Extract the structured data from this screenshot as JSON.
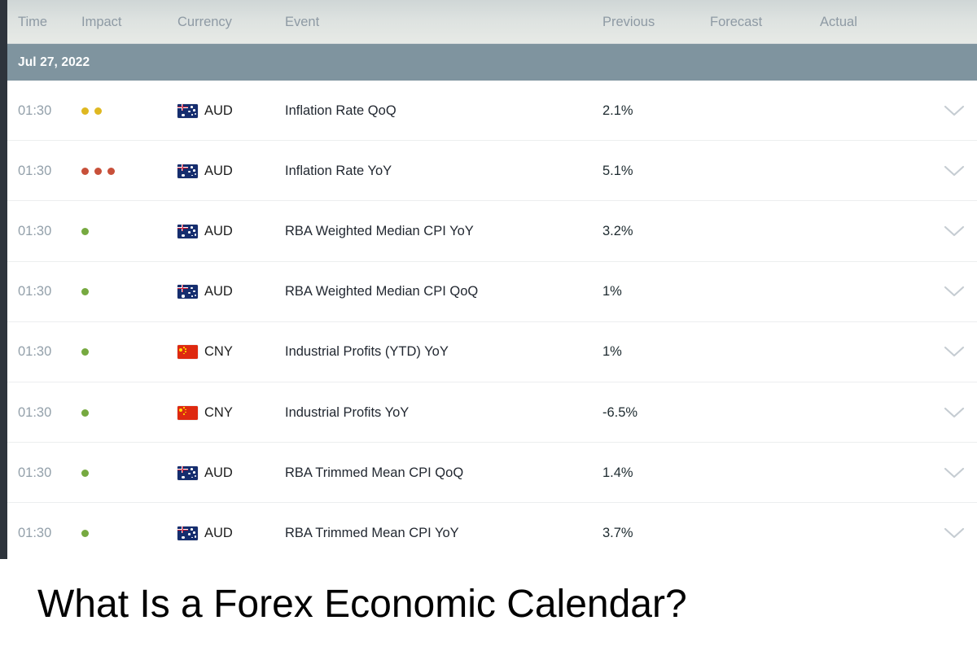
{
  "caption": "What Is a Forex Economic Calendar?",
  "calendar": {
    "columns": {
      "time": "Time",
      "impact": "Impact",
      "currency": "Currency",
      "event": "Event",
      "previous": "Previous",
      "forecast": "Forecast",
      "actual": "Actual"
    },
    "date_banner": "Jul 27, 2022",
    "colors": {
      "banner_bg": "#7f949f",
      "header_bg": "#dde2e0",
      "left_rail": "#2e343c",
      "impact_low": "#76a940",
      "impact_medium": "#dfb821",
      "impact_high": "#c8503a",
      "row_divider": "#eceeef"
    },
    "rows": [
      {
        "time": "01:30",
        "impact_level": 2,
        "impact_label": "medium",
        "flag": "aud-flag",
        "currency": "AUD",
        "event": "Inflation Rate QoQ",
        "previous": "2.1%",
        "forecast": "",
        "actual": "",
        "expand_icon": "chevron-down-icon"
      },
      {
        "time": "01:30",
        "impact_level": 3,
        "impact_label": "high",
        "flag": "aud-flag",
        "currency": "AUD",
        "event": "Inflation Rate YoY",
        "previous": "5.1%",
        "forecast": "",
        "actual": "",
        "expand_icon": "chevron-down-icon"
      },
      {
        "time": "01:30",
        "impact_level": 1,
        "impact_label": "low",
        "flag": "aud-flag",
        "currency": "AUD",
        "event": "RBA Weighted Median CPI YoY",
        "previous": "3.2%",
        "forecast": "",
        "actual": "",
        "expand_icon": "chevron-down-icon"
      },
      {
        "time": "01:30",
        "impact_level": 1,
        "impact_label": "low",
        "flag": "aud-flag",
        "currency": "AUD",
        "event": "RBA Weighted Median CPI QoQ",
        "previous": "1%",
        "forecast": "",
        "actual": "",
        "expand_icon": "chevron-down-icon"
      },
      {
        "time": "01:30",
        "impact_level": 1,
        "impact_label": "low",
        "flag": "cny-flag",
        "currency": "CNY",
        "event": "Industrial Profits (YTD) YoY",
        "previous": "1%",
        "forecast": "",
        "actual": "",
        "expand_icon": "chevron-down-icon"
      },
      {
        "time": "01:30",
        "impact_level": 1,
        "impact_label": "low",
        "flag": "cny-flag",
        "currency": "CNY",
        "event": "Industrial Profits YoY",
        "previous": "-6.5%",
        "forecast": "",
        "actual": "",
        "expand_icon": "chevron-down-icon"
      },
      {
        "time": "01:30",
        "impact_level": 1,
        "impact_label": "low",
        "flag": "aud-flag",
        "currency": "AUD",
        "event": "RBA Trimmed Mean CPI QoQ",
        "previous": "1.4%",
        "forecast": "",
        "actual": "",
        "expand_icon": "chevron-down-icon"
      },
      {
        "time": "01:30",
        "impact_level": 1,
        "impact_label": "low",
        "flag": "aud-flag",
        "currency": "AUD",
        "event": "RBA Trimmed Mean CPI YoY",
        "previous": "3.7%",
        "forecast": "",
        "actual": "",
        "expand_icon": "chevron-down-icon"
      }
    ]
  }
}
